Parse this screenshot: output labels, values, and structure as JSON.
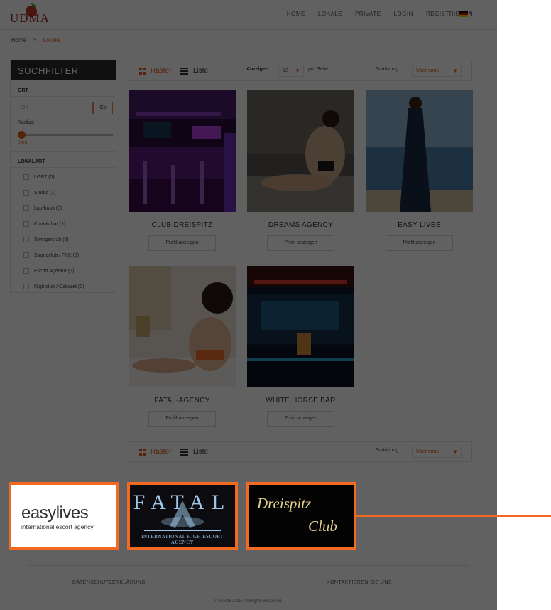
{
  "header": {
    "logo_text": "UDMA",
    "nav": [
      "HOME",
      "LOKALE",
      "PRIVATE",
      "LOGIN",
      "REGISTRIEREN"
    ],
    "flag_colors": [
      "#000000",
      "#dd0000",
      "#ffce00"
    ]
  },
  "breadcrumb": {
    "home": "Home",
    "separator": ">",
    "current": "Lokale"
  },
  "sidebar": {
    "title": "SUCHFILTER",
    "ort_label": "ORT",
    "ort_placeholder": "Ort",
    "go_label": "Go",
    "radius_label": "Radius:",
    "radius_value": "0 km",
    "lokalart_label": "LOKALART",
    "categories": [
      "LGBT (0)",
      "Studio (1)",
      "Laufhaus (0)",
      "Kontaktbar (1)",
      "Swingerclub (0)",
      "Saunaclub / FKK (0)",
      "Escort Agentur (3)",
      "Nightclub / Cabaret (0)"
    ]
  },
  "toolbar": {
    "raster": "Raster",
    "liste": "Liste",
    "show_label": "Anzeigen",
    "show_value": "12",
    "per_page": "pro Seite",
    "sort_label": "Sortierung",
    "sort_value": "Username"
  },
  "cards": [
    {
      "name": "CLUB DREISPITZ",
      "button": "Profil anzeigen"
    },
    {
      "name": "DREAMS AGENCY",
      "button": "Profil anzeigen"
    },
    {
      "name": "EASY LIVES",
      "button": "Profil anzeigen"
    },
    {
      "name": "FATAL-AGENCY",
      "button": "Profil anzeigen"
    },
    {
      "name": "WHITE HORSE BAR",
      "button": "Profil anzeigen"
    }
  ],
  "footer": {
    "privacy": "DATENSCHUTZERKLÄRUNG",
    "contact": "KONTAKTIEREN SIE UNS",
    "copyright": "© MiRoti 2018. All Rights Reserved."
  },
  "logos": {
    "easylives_word": "easylives",
    "easylives_sub": "international escort agency",
    "fatal_word": "FATAL",
    "fatal_sub": "INTERNATIONAL HIGH ESCORT AGENCY",
    "dreispitz_line1": "Dreispitz",
    "dreispitz_line2": "Club"
  },
  "colors": {
    "accent": "#e25c1a",
    "highlight_border": "#f26a21"
  }
}
